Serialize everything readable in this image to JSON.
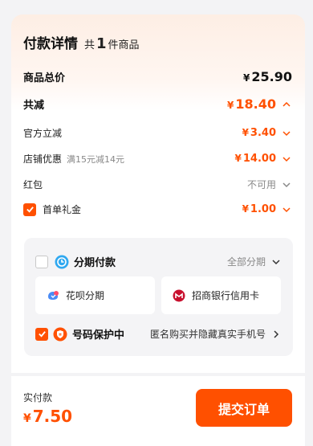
{
  "header": {
    "title": "付款详情",
    "count_prefix": "共",
    "count": "1",
    "count_suffix": "件商品"
  },
  "rows": {
    "total": {
      "label": "商品总价",
      "currency": "¥",
      "amount": "25.90"
    },
    "discount_total": {
      "label": "共减",
      "currency": "¥",
      "amount": "18.40"
    },
    "official": {
      "label": "官方立减",
      "currency": "¥",
      "amount": "3.40"
    },
    "store": {
      "label": "店铺优惠",
      "sub": "满15元减14元",
      "currency": "¥",
      "amount": "14.00"
    },
    "redpacket": {
      "label": "红包",
      "value": "不可用"
    },
    "first_gift": {
      "label": "首单礼金",
      "currency": "¥",
      "amount": "1.00",
      "checked": true
    }
  },
  "installment": {
    "label": "分期付款",
    "all_label": "全部分期",
    "options": [
      {
        "label": "花呗分期",
        "icon": "huabei-icon"
      },
      {
        "label": "招商银行信用卡",
        "icon": "cmb-bank-icon"
      }
    ]
  },
  "privacy": {
    "label": "号码保护中",
    "desc": "匿名购买并隐藏真实手机号",
    "checked": true
  },
  "footer": {
    "pay_label": "实付款",
    "currency": "¥",
    "pay_amount": "7.50",
    "submit_label": "提交订单"
  },
  "colors": {
    "accent": "#ff5000",
    "panel_bg": "#f4f4f6",
    "page_bg": "#f3f3f5"
  }
}
